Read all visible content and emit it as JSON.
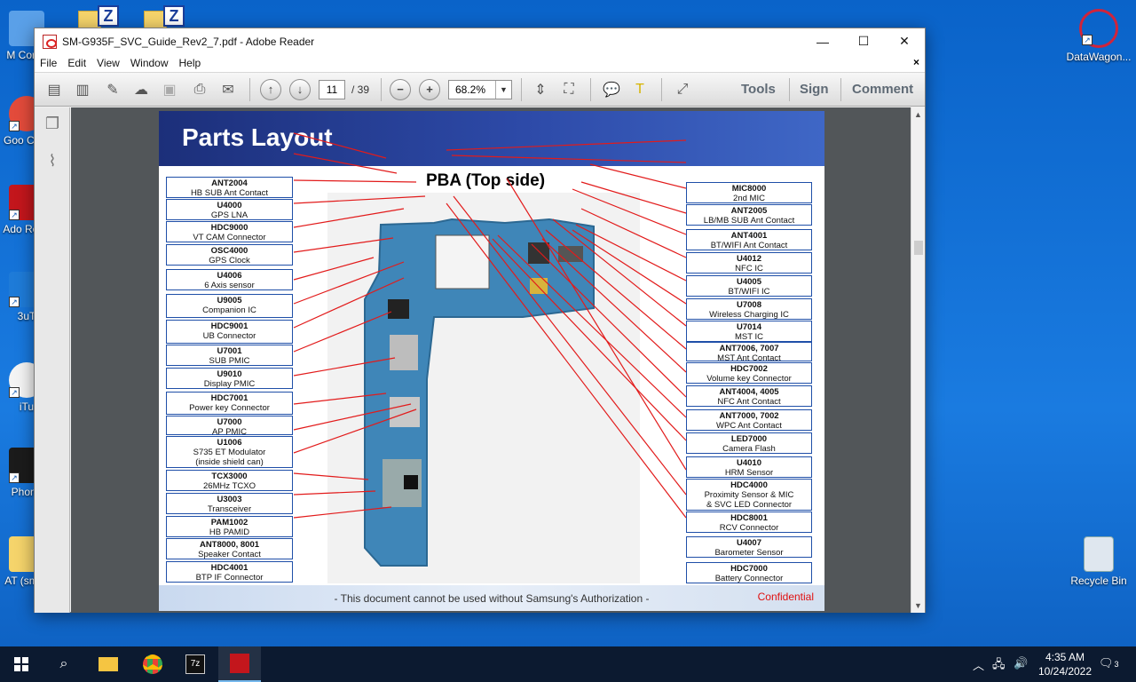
{
  "desktop": {
    "icons_left": [
      {
        "label": "M Comp",
        "partial": true
      },
      {
        "label": "Goo Chro",
        "partial": true
      },
      {
        "label": "Ado Read",
        "partial": true
      },
      {
        "label": "3uT",
        "partial": true
      },
      {
        "label": "iTu",
        "partial": true
      },
      {
        "label": "Phone",
        "partial": true
      },
      {
        "label": "AT (sm-A",
        "partial": true
      }
    ],
    "icon_datawagon": "DataWagon...",
    "icon_recycle": "Recycle Bin"
  },
  "window": {
    "title": "SM-G935F_SVC_Guide_Rev2_7.pdf - Adobe Reader",
    "controls": {
      "minimize": "—",
      "maximize": "☐",
      "close": "✕"
    },
    "menu": [
      "File",
      "Edit",
      "View",
      "Window",
      "Help"
    ],
    "close_doc": "×"
  },
  "toolbar": {
    "page_current": "11",
    "page_total": "/ 39",
    "zoom": "68.2%",
    "tools": "Tools",
    "sign": "Sign",
    "comment": "Comment"
  },
  "slide": {
    "title": "Parts Layout",
    "subtitle": "PBA (Top side)",
    "footer": "- This document cannot be used without Samsung's Authorization -",
    "confidential": "Confidential",
    "left_parts": [
      {
        "id": "ANT2004",
        "desc": "HB SUB Ant Contact"
      },
      {
        "id": "U4000",
        "desc": "GPS LNA"
      },
      {
        "id": "HDC9000",
        "desc": "VT CAM Connector"
      },
      {
        "id": "OSC4000",
        "desc": "GPS Clock"
      },
      {
        "id": "U4006",
        "desc": "6 Axis sensor"
      },
      {
        "id": "U9005",
        "desc": "Companion IC"
      },
      {
        "id": "HDC9001",
        "desc": "UB Connector"
      },
      {
        "id": "U7001",
        "desc": "SUB PMIC"
      },
      {
        "id": "U9010",
        "desc": "Display PMIC"
      },
      {
        "id": "HDC7001",
        "desc": "Power key Connector"
      },
      {
        "id": "U7000",
        "desc": "AP PMIC"
      },
      {
        "id": "U1006",
        "desc": "S735 ET Modulator",
        "desc2": "(inside shield can)"
      },
      {
        "id": "TCX3000",
        "desc": "26MHz TCXO"
      },
      {
        "id": "U3003",
        "desc": "Transceiver"
      },
      {
        "id": "PAM1002",
        "desc": "HB PAMID"
      },
      {
        "id": "ANT8000, 8001",
        "desc": "Speaker Contact"
      },
      {
        "id": "HDC4001",
        "desc": "BTP IF Connector"
      }
    ],
    "right_parts": [
      {
        "id": "MIC8000",
        "desc": "2nd MIC"
      },
      {
        "id": "ANT2005",
        "desc": "LB/MB SUB Ant Contact"
      },
      {
        "id": "ANT4001",
        "desc": "BT/WIFI Ant Contact"
      },
      {
        "id": "U4012",
        "desc": "NFC IC"
      },
      {
        "id": "U4005",
        "desc": "BT/WIFI IC"
      },
      {
        "id": "U7008",
        "desc": "Wireless Charging IC"
      },
      {
        "id": "U7014",
        "desc": "MST IC"
      },
      {
        "id": "ANT7006, 7007",
        "desc": "MST Ant Contact"
      },
      {
        "id": "HDC7002",
        "desc": "Volume key Connector"
      },
      {
        "id": "ANT4004, 4005",
        "desc": "NFC Ant Contact"
      },
      {
        "id": "ANT7000, 7002",
        "desc": "WPC Ant Contact"
      },
      {
        "id": "LED7000",
        "desc": "Camera Flash"
      },
      {
        "id": "U4010",
        "desc": "HRM Sensor"
      },
      {
        "id": "HDC4000",
        "desc": "Proximity Sensor & MIC",
        "desc2": "& SVC LED Connector"
      },
      {
        "id": "HDC8001",
        "desc": "RCV Connector"
      },
      {
        "id": "U4007",
        "desc": "Barometer Sensor"
      },
      {
        "id": "HDC7000",
        "desc": "Battery Connector"
      }
    ]
  },
  "taskbar": {
    "time": "4:35 AM",
    "date": "10/24/2022",
    "notification_count": "3"
  }
}
